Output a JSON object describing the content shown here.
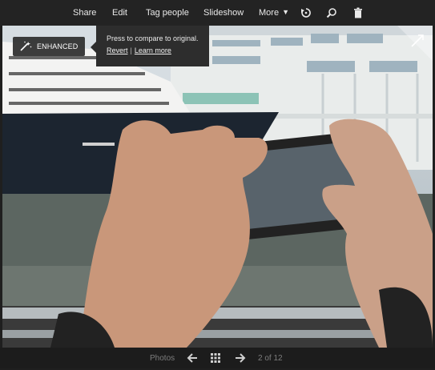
{
  "toolbar": {
    "share": "Share",
    "edit": "Edit",
    "tag_people": "Tag people",
    "slideshow": "Slideshow",
    "more": "More"
  },
  "enhance": {
    "badge_label": "ENHANCED",
    "tooltip_text": "Press to compare to original.",
    "revert": "Revert",
    "separator": "|",
    "learn_more": "Learn more"
  },
  "bottom_nav": {
    "photos": "Photos",
    "counter": "2 of 12"
  },
  "icons": {
    "more": "chevron-down-icon",
    "rotate": "rotate-icon",
    "search": "search-icon",
    "delete": "trash-icon",
    "expand": "expand-icon",
    "magic": "magic-wand-icon",
    "prev": "arrow-left-icon",
    "grid": "grid-icon",
    "next": "arrow-right-icon"
  },
  "colors": {
    "toolbar_bg": "#232323",
    "toolbar_text": "#e9e9e9",
    "bottom_text": "#7d7d7d"
  }
}
